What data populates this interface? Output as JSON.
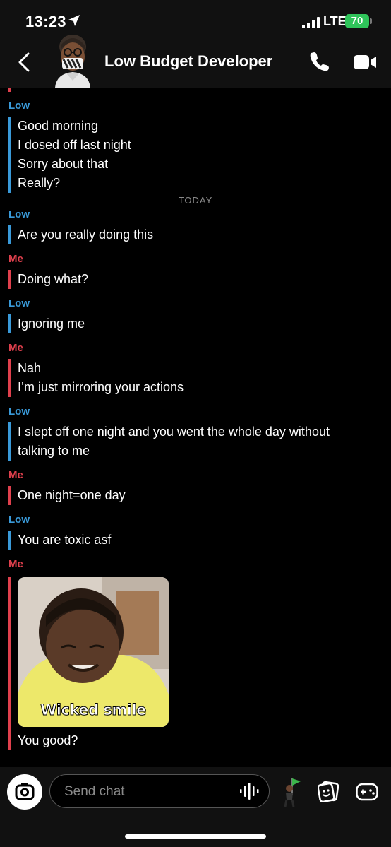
{
  "status_bar": {
    "time": "13:23",
    "network": "LTE",
    "battery": "70"
  },
  "header": {
    "contact_name": "Low Budget Developer",
    "icons": [
      "back-chevron-icon",
      "bitmoji-avatar",
      "phone-call-icon",
      "video-call-icon"
    ]
  },
  "chat": {
    "date_divider": "TODAY",
    "groups": [
      {
        "sender": "Low",
        "lines": [
          "Good morning",
          "I dosed off last night",
          "Sorry about that",
          "Really?"
        ]
      },
      {
        "sender": "Low",
        "lines": [
          "Are you really doing this"
        ]
      },
      {
        "sender": "Me",
        "lines": [
          "Doing what?"
        ]
      },
      {
        "sender": "Low",
        "lines": [
          "Ignoring me"
        ]
      },
      {
        "sender": "Me",
        "lines": [
          "Nah",
          "I’m just mirroring your actions"
        ]
      },
      {
        "sender": "Low",
        "lines": [
          "I slept off one night and you went the whole day without",
          "talking to me"
        ]
      },
      {
        "sender": "Me",
        "lines": [
          "One night=one day"
        ]
      },
      {
        "sender": "Low",
        "lines": [
          "You are toxic asf"
        ]
      },
      {
        "sender": "Me",
        "image_caption": "Wicked smile",
        "lines": [
          "You good?"
        ]
      }
    ]
  },
  "composer": {
    "placeholder": "Send chat"
  },
  "colors": {
    "low_accent": "#3a9ad9",
    "me_accent": "#e0404d",
    "battery_green": "#2fc45a",
    "background": "#000000"
  }
}
